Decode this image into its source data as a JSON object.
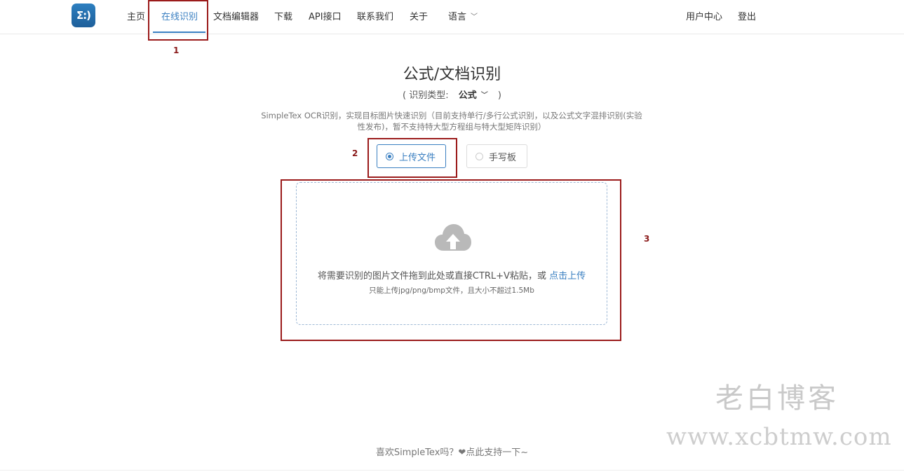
{
  "brand": {
    "logo_text": "Σ:)"
  },
  "nav": {
    "items": [
      {
        "label": "主页"
      },
      {
        "label": "在线识别"
      },
      {
        "label": "文档编辑器"
      },
      {
        "label": "下载"
      },
      {
        "label": "API接口"
      },
      {
        "label": "联系我们"
      },
      {
        "label": "关于"
      },
      {
        "label": "语言"
      }
    ],
    "active": "在线识别",
    "right": [
      {
        "label": "用户中心"
      },
      {
        "label": "登出"
      }
    ]
  },
  "annotations": [
    {
      "label": "1"
    },
    {
      "label": "2"
    },
    {
      "label": "3"
    }
  ],
  "main": {
    "title": "公式/文档识别",
    "subtitle_prefix": "( 识别类型:",
    "type_value": "公式",
    "subtitle_suffix": ")",
    "description": "SimpleTex OCR识别，实现目标图片快速识别（目前支持单行/多行公式识别，以及公式文字混排识别(实验性发布)，暂不支持特大型方程组与特大型矩阵识别）",
    "modes": [
      {
        "label": "上传文件",
        "selected": true
      },
      {
        "label": "手写板",
        "selected": false
      }
    ],
    "upload": {
      "icon": "cloud-upload-icon",
      "text": "将需要识别的图片文件拖到此处或直接CTRL+V粘贴，或",
      "link": "点击上传",
      "hint": "只能上传jpg/png/bmp文件，且大小不超过1.5Mb"
    }
  },
  "footer": {
    "text": "喜欢SimpleTex吗？❤点此支持一下~"
  },
  "watermark": {
    "title": "老白博客",
    "url": "www.xcbtmw.com"
  },
  "colors": {
    "accent": "#3a7fc1",
    "annotation": "#9b1b1b",
    "logo_bg": "#2d7fc0"
  }
}
